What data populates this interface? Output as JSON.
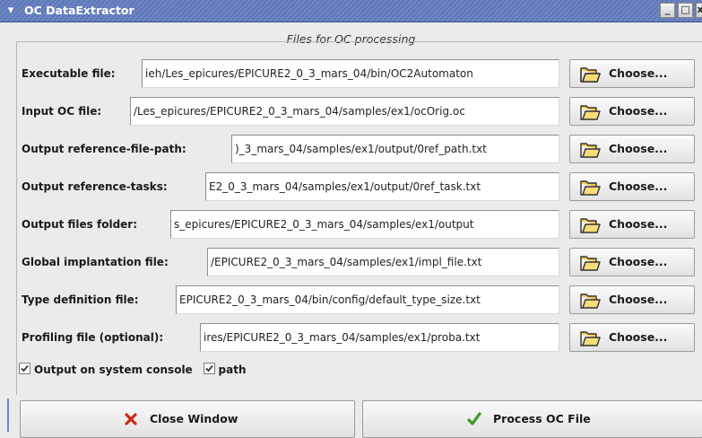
{
  "window": {
    "title": "OC DataExtractor",
    "menu_glyph": "▾",
    "minimize_glyph": "_",
    "maximize_glyph": "□",
    "close_glyph": "x"
  },
  "section_title": "Files for OC processing",
  "rows": [
    {
      "label": "Executable file:",
      "value": "ieh/Les_epicures/EPICURE2_0_3_mars_04/bin/OC2Automaton",
      "button": "Choose..."
    },
    {
      "label": "Input OC file:",
      "value": "/Les_epicures/EPICURE2_0_3_mars_04/samples/ex1/ocOrig.oc",
      "button": "Choose..."
    },
    {
      "label": "Output reference-file-path:",
      "value": ")_3_mars_04/samples/ex1/output/0ref_path.txt",
      "button": "Choose..."
    },
    {
      "label": "Output reference-tasks:",
      "value": "E2_0_3_mars_04/samples/ex1/output/0ref_task.txt",
      "button": "Choose..."
    },
    {
      "label": "Output files folder:",
      "value": "s_epicures/EPICURE2_0_3_mars_04/samples/ex1/output",
      "button": "Choose..."
    },
    {
      "label": "Global implantation file:",
      "value": "/EPICURE2_0_3_mars_04/samples/ex1/impl_file.txt",
      "button": "Choose..."
    },
    {
      "label": "Type definition file:",
      "value": "EPICURE2_0_3_mars_04/bin/config/default_type_size.txt",
      "button": "Choose..."
    },
    {
      "label": "Profiling file (optional):",
      "value": "ires/EPICURE2_0_3_mars_04/samples/ex1/proba.txt",
      "button": "Choose..."
    }
  ],
  "checkboxes": [
    {
      "label": "Output on system console",
      "checked": true
    },
    {
      "label": "path",
      "checked": true
    }
  ],
  "buttons": {
    "close": "Close Window",
    "process": "Process OC File"
  },
  "colors": {
    "titlebar": "#6e86c2",
    "close_icon": "#cc2a1a",
    "process_icon": "#3f9a28"
  }
}
